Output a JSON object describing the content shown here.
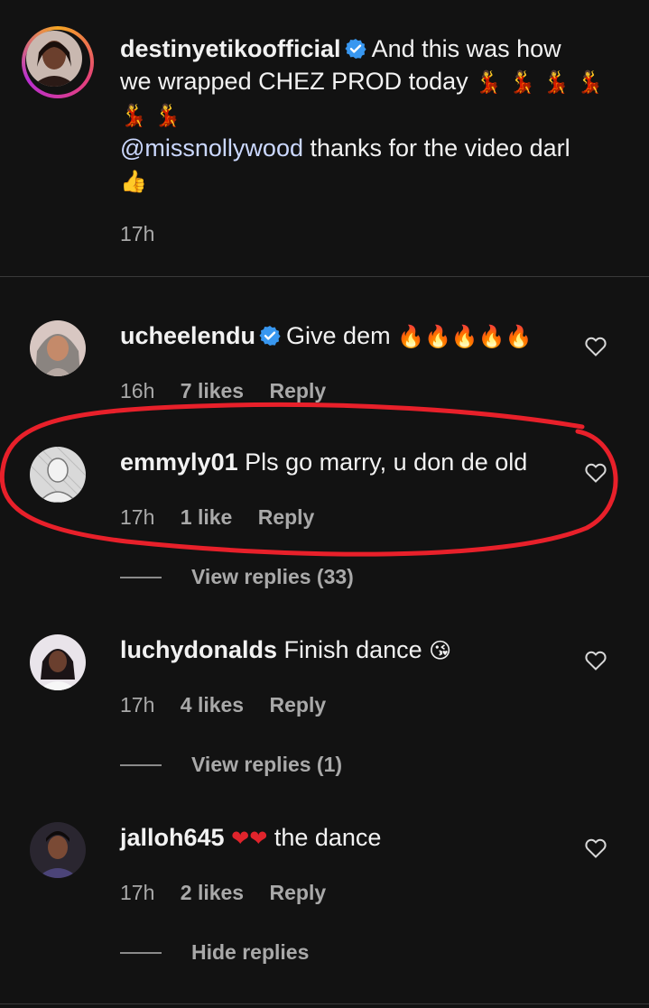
{
  "post": {
    "username": "destinyetikoofficial",
    "caption_line1": "And this was how",
    "caption_line2": "we wrapped CHEZ PROD today",
    "caption_emojis_a": "💃 💃 💃 💃",
    "caption_emojis_b": "💃 💃",
    "mention": "@missnollywood",
    "caption_line3": " thanks for the video darl",
    "caption_emoji_end": "👍",
    "time": "17h"
  },
  "comments": [
    {
      "username": "ucheelendu",
      "verified": true,
      "text": "Give dem",
      "emojis": "🔥🔥🔥🔥🔥",
      "time": "16h",
      "likes": "7 likes",
      "reply": "Reply"
    },
    {
      "username": "emmyly01",
      "text": "Pls go marry, u don de old",
      "time": "17h",
      "likes": "1 like",
      "reply": "Reply",
      "view_replies": "View replies (33)"
    },
    {
      "username": "luchydonalds",
      "text": "Finish dance",
      "emojis": "😘",
      "time": "17h",
      "likes": "4 likes",
      "reply": "Reply",
      "view_replies": "View replies (1)"
    },
    {
      "username": "jalloh645",
      "emojis": "❤❤",
      "text": "the dance",
      "time": "17h",
      "likes": "2 likes",
      "reply": "Reply",
      "view_replies": "Hide replies"
    }
  ],
  "colors": {
    "background": "#121212",
    "secondary_text": "#a9a9a9",
    "mention": "#cbd8ff",
    "verified": "#3897f0",
    "annotation": "#e8202a"
  }
}
